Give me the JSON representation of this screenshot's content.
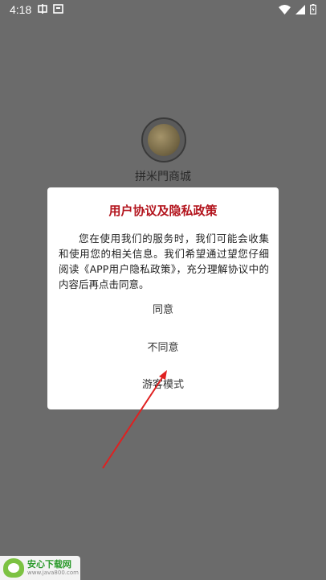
{
  "status_bar": {
    "time": "4:18",
    "left_icons": [
      "app-notification-icon",
      "screenshot-icon"
    ],
    "right_icons": [
      "wifi-icon",
      "cellular-signal-icon",
      "battery-icon"
    ]
  },
  "app": {
    "name": "拼米門商城"
  },
  "dialog": {
    "title": "用户协议及隐私政策",
    "body": "您在使用我们的服务时，我们可能会收集和使用您的相关信息。我们希望通过望您仔细阅读《APP用户隐私政策》，充分理解协议中的内容后再点击同意。",
    "agree_label": "同意",
    "disagree_label": "不同意",
    "guest_label": "游客模式"
  },
  "watermark": {
    "name": "安心下载网",
    "url": "www.java800.com"
  },
  "colors": {
    "overlay": "#6b6b6b",
    "title": "#b3141d",
    "annotation_arrow": "#e02020"
  }
}
